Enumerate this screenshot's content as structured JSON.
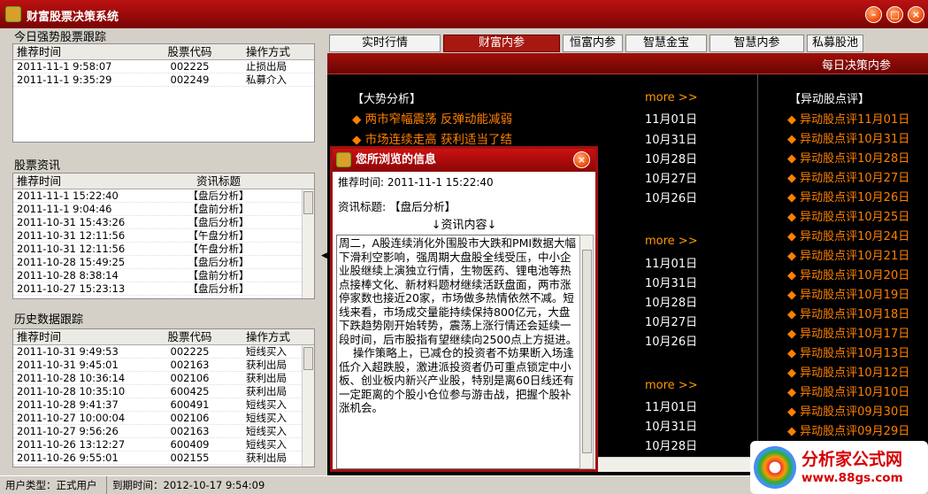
{
  "app_title": "财富股票决策系统",
  "left": {
    "strong_track": {
      "title": "今日强势股票跟踪",
      "headers": [
        "推荐时间",
        "股票代码",
        "操作方式"
      ],
      "rows": [
        [
          "2011-11-1 9:58:07",
          "002225",
          "止损出局"
        ],
        [
          "2011-11-1 9:35:29",
          "002249",
          "私募介入"
        ]
      ]
    },
    "stock_news": {
      "title": "股票资讯",
      "headers": [
        "推荐时间",
        "资讯标题"
      ],
      "rows": [
        [
          "2011-11-1 15:22:40",
          "【盘后分析】"
        ],
        [
          "2011-11-1 9:04:46",
          "【盘前分析】"
        ],
        [
          "2011-10-31 15:43:26",
          "【盘后分析】"
        ],
        [
          "2011-10-31 12:11:56",
          "【午盘分析】"
        ],
        [
          "2011-10-31 12:11:56",
          "【午盘分析】"
        ],
        [
          "2011-10-28 15:49:25",
          "【盘后分析】"
        ],
        [
          "2011-10-28 8:38:14",
          "【盘前分析】"
        ],
        [
          "2011-10-27 15:23:13",
          "【盘后分析】"
        ]
      ]
    },
    "history": {
      "title": "历史数据跟踪",
      "headers": [
        "推荐时间",
        "股票代码",
        "操作方式"
      ],
      "rows": [
        [
          "2011-10-31 9:49:53",
          "002225",
          "短线买入"
        ],
        [
          "2011-10-31 9:45:01",
          "002163",
          "获利出局"
        ],
        [
          "2011-10-28 10:36:14",
          "002106",
          "获利出局"
        ],
        [
          "2011-10-28 10:35:10",
          "600425",
          "获利出局"
        ],
        [
          "2011-10-28 9:41:37",
          "600491",
          "短线买入"
        ],
        [
          "2011-10-27 10:00:04",
          "002106",
          "短线买入"
        ],
        [
          "2011-10-27 9:56:26",
          "002163",
          "短线买入"
        ],
        [
          "2011-10-26 13:12:27",
          "600409",
          "短线买入"
        ],
        [
          "2011-10-26 9:55:01",
          "002155",
          "获利出局"
        ]
      ]
    }
  },
  "tabs": [
    "实时行情",
    "财富内参",
    "恒富内参",
    "智慧金宝",
    "智慧内参",
    "私募股池"
  ],
  "active_tab": 1,
  "main": {
    "banner": "每日决策内参",
    "analysis_title": "【大势分析】",
    "news": [
      "◆ 两市窄幅震荡  反弹动能减弱",
      "◆ 市场连续走高  获利适当了结"
    ],
    "more": [
      "more >>",
      "more >>",
      "more >>"
    ],
    "dates_1": [
      "11月01日",
      "10月31日",
      "10月28日",
      "10月27日",
      "10月26日"
    ],
    "dates_2": [
      "11月01日",
      "10月31日",
      "10月28日",
      "10月27日",
      "10月26日"
    ],
    "dates_3": [
      "11月01日",
      "10月31日",
      "10月28日"
    ],
    "yidong_title": "【异动股点评】",
    "yidong": [
      "◆ 异动股点评11月01日",
      "◆ 异动股点评10月31日",
      "◆ 异动股点评10月28日",
      "◆ 异动股点评10月27日",
      "◆ 异动股点评10月26日",
      "◆ 异动股点评10月25日",
      "◆ 异动股点评10月24日",
      "◆ 异动股点评10月21日",
      "◆ 异动股点评10月20日",
      "◆ 异动股点评10月19日",
      "◆ 异动股点评10月18日",
      "◆ 异动股点评10月17日",
      "◆ 异动股点评10月13日",
      "◆ 异动股点评10月12日",
      "◆ 异动股点评10月10日",
      "◆ 异动股点评09月30日",
      "◆ 异动股点评09月29日"
    ]
  },
  "popup": {
    "title": "您所浏览的信息",
    "time": "推荐时间: 2011-11-1 15:22:40",
    "subject": "资讯标题: 【盘后分析】",
    "content_label": "↓资讯内容↓",
    "body": "周二，A股连续消化外围股市大跌和PMI数据大幅下滑利空影响，强周期大盘股全线受压，中小企业股继续上演独立行情，生物医药、锂电池等热点接棒文化、新材料题材继续活跃盘面，两市涨停家数也接近20家，市场做多热情依然不减。短线来看，市场成交量能持续保持800亿元，大盘下跌趋势刚开始转势，震荡上涨行情还会延续一段时间，后市股指有望继续向2500点上方挺进。\n    操作策略上，已减仓的投资者不妨果断入场逢低介入超跌股，激进派投资者仍可重点锁定中小板、创业板内新兴产业股，特别是离60日线还有一定距离的个股小仓位参与游击战，把握个股补涨机会。"
  },
  "status": {
    "user_type": "用户类型：正式用户",
    "expire": "到期时间：2012-10-17 9:54:09"
  },
  "watermark": {
    "name": "分析家公式网",
    "url": "www.88gs.com"
  }
}
